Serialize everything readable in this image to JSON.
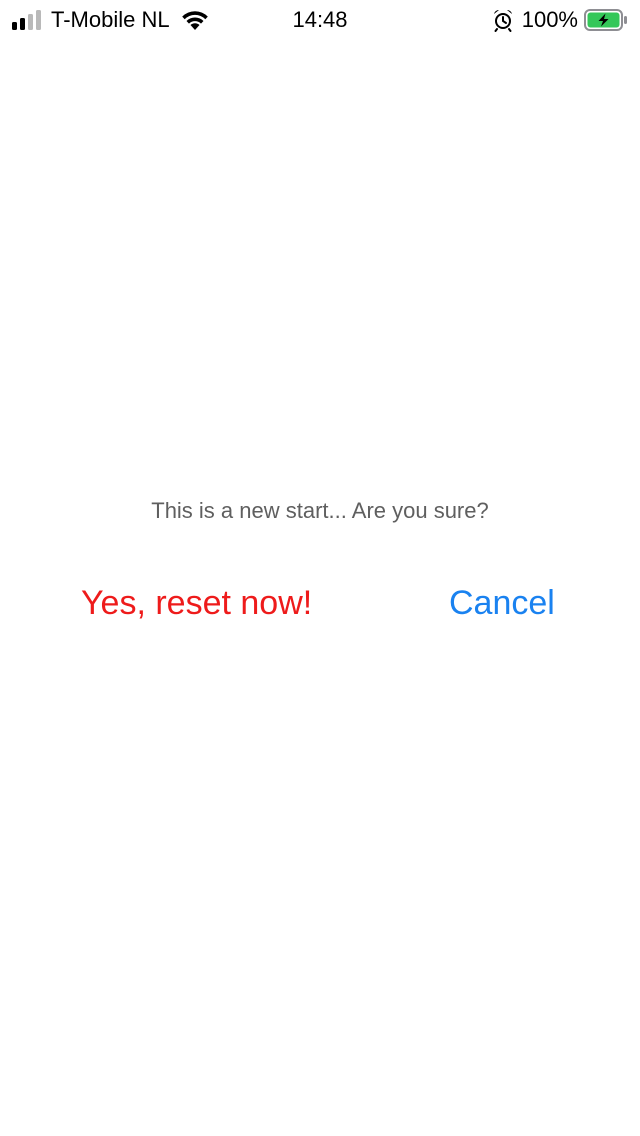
{
  "status_bar": {
    "carrier": "T-Mobile NL",
    "time": "14:48",
    "battery_percent": "100%",
    "icons": {
      "signal": "cellular-signal-icon",
      "wifi": "wifi-icon",
      "alarm": "alarm-clock-icon",
      "battery": "battery-charging-icon"
    },
    "signal_bars_active": 2,
    "signal_bars_total": 4,
    "battery_level": 1.0,
    "battery_color": "#34c759"
  },
  "dialog": {
    "prompt": "This is a new start... Are you sure?",
    "confirm_label": "Yes, reset now!",
    "cancel_label": "Cancel",
    "confirm_color": "#ee1b1b",
    "cancel_color": "#1a82f0"
  }
}
